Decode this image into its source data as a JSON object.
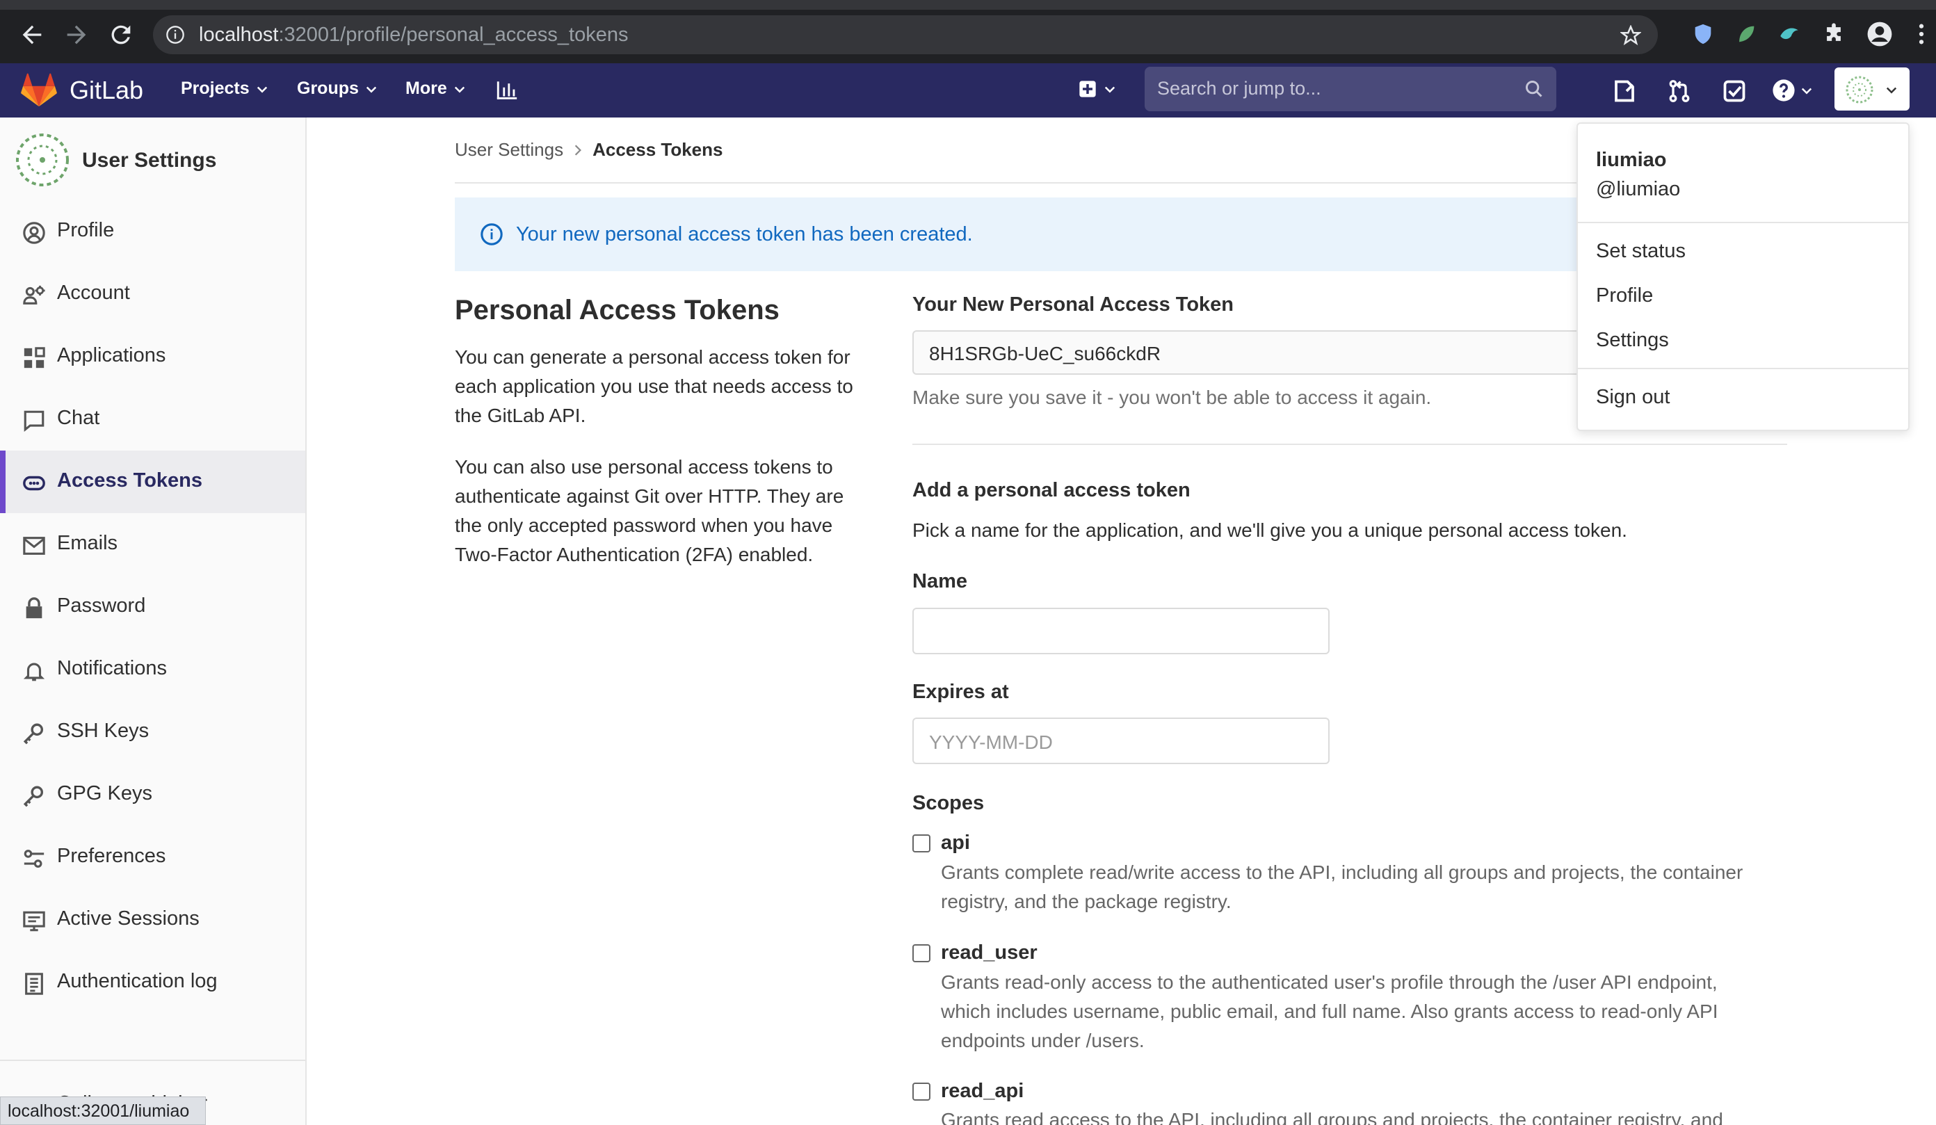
{
  "browser": {
    "url_host": "localhost",
    "url_path": ":32001/profile/personal_access_tokens",
    "status_url": "localhost:32001/liumiao"
  },
  "navbar": {
    "brand": "GitLab",
    "menus": [
      "Projects",
      "Groups",
      "More"
    ],
    "search_placeholder": "Search or jump to..."
  },
  "sidebar": {
    "title": "User Settings",
    "items": [
      {
        "label": "Profile",
        "icon": "profile-icon"
      },
      {
        "label": "Account",
        "icon": "account-icon"
      },
      {
        "label": "Applications",
        "icon": "applications-icon"
      },
      {
        "label": "Chat",
        "icon": "chat-icon"
      },
      {
        "label": "Access Tokens",
        "icon": "token-icon",
        "active": true
      },
      {
        "label": "Emails",
        "icon": "mail-icon"
      },
      {
        "label": "Password",
        "icon": "lock-icon"
      },
      {
        "label": "Notifications",
        "icon": "bell-icon"
      },
      {
        "label": "SSH Keys",
        "icon": "key-icon"
      },
      {
        "label": "GPG Keys",
        "icon": "key-icon"
      },
      {
        "label": "Preferences",
        "icon": "preferences-icon"
      },
      {
        "label": "Active Sessions",
        "icon": "monitor-icon"
      },
      {
        "label": "Authentication log",
        "icon": "log-icon"
      }
    ],
    "collapse_label": "Collapse sidebar"
  },
  "breadcrumb": {
    "parent": "User Settings",
    "current": "Access Tokens"
  },
  "flash": {
    "message": "Your new personal access token has been created."
  },
  "left_column": {
    "title": "Personal Access Tokens",
    "para1": "You can generate a personal access token for each application you use that needs access to the GitLab API.",
    "para2": "You can also use personal access tokens to authenticate against Git over HTTP. They are the only accepted password when you have Two-Factor Authentication (2FA) enabled."
  },
  "new_token": {
    "label": "Your New Personal Access Token",
    "value": "8H1SRGb-UeC_su66ckdR",
    "hint": "Make sure you save it - you won't be able to access it again."
  },
  "add_token": {
    "title": "Add a personal access token",
    "description": "Pick a name for the application, and we'll give you a unique personal access token.",
    "name_label": "Name",
    "name_value": "",
    "expires_label": "Expires at",
    "expires_placeholder": "YYYY-MM-DD",
    "scopes_label": "Scopes",
    "scopes": [
      {
        "name": "api",
        "desc1": "Grants complete read/write access to the API, including all groups and projects, the container",
        "desc2": "registry, and the package registry.",
        "desc3": "",
        "checked": false
      },
      {
        "name": "read_user",
        "desc1": "Grants read-only access to the authenticated user's profile through the /user API endpoint,",
        "desc2": "which includes username, public email, and full name. Also grants access to read-only API",
        "desc3": "endpoints under /users.",
        "checked": false
      },
      {
        "name": "read_api",
        "desc1": "Grants read access to the API, including all groups and projects, the container registry, and",
        "desc2": "",
        "desc3": "",
        "checked": false
      }
    ]
  },
  "user_dropdown": {
    "name": "liumiao",
    "username": "@liumiao",
    "items": [
      "Set status",
      "Profile",
      "Settings"
    ],
    "sign_out": "Sign out"
  },
  "colors": {
    "navbar": "#292961",
    "accent": "#6e49cb",
    "info_bg": "#e9f3fc",
    "info_text": "#1068bf"
  }
}
